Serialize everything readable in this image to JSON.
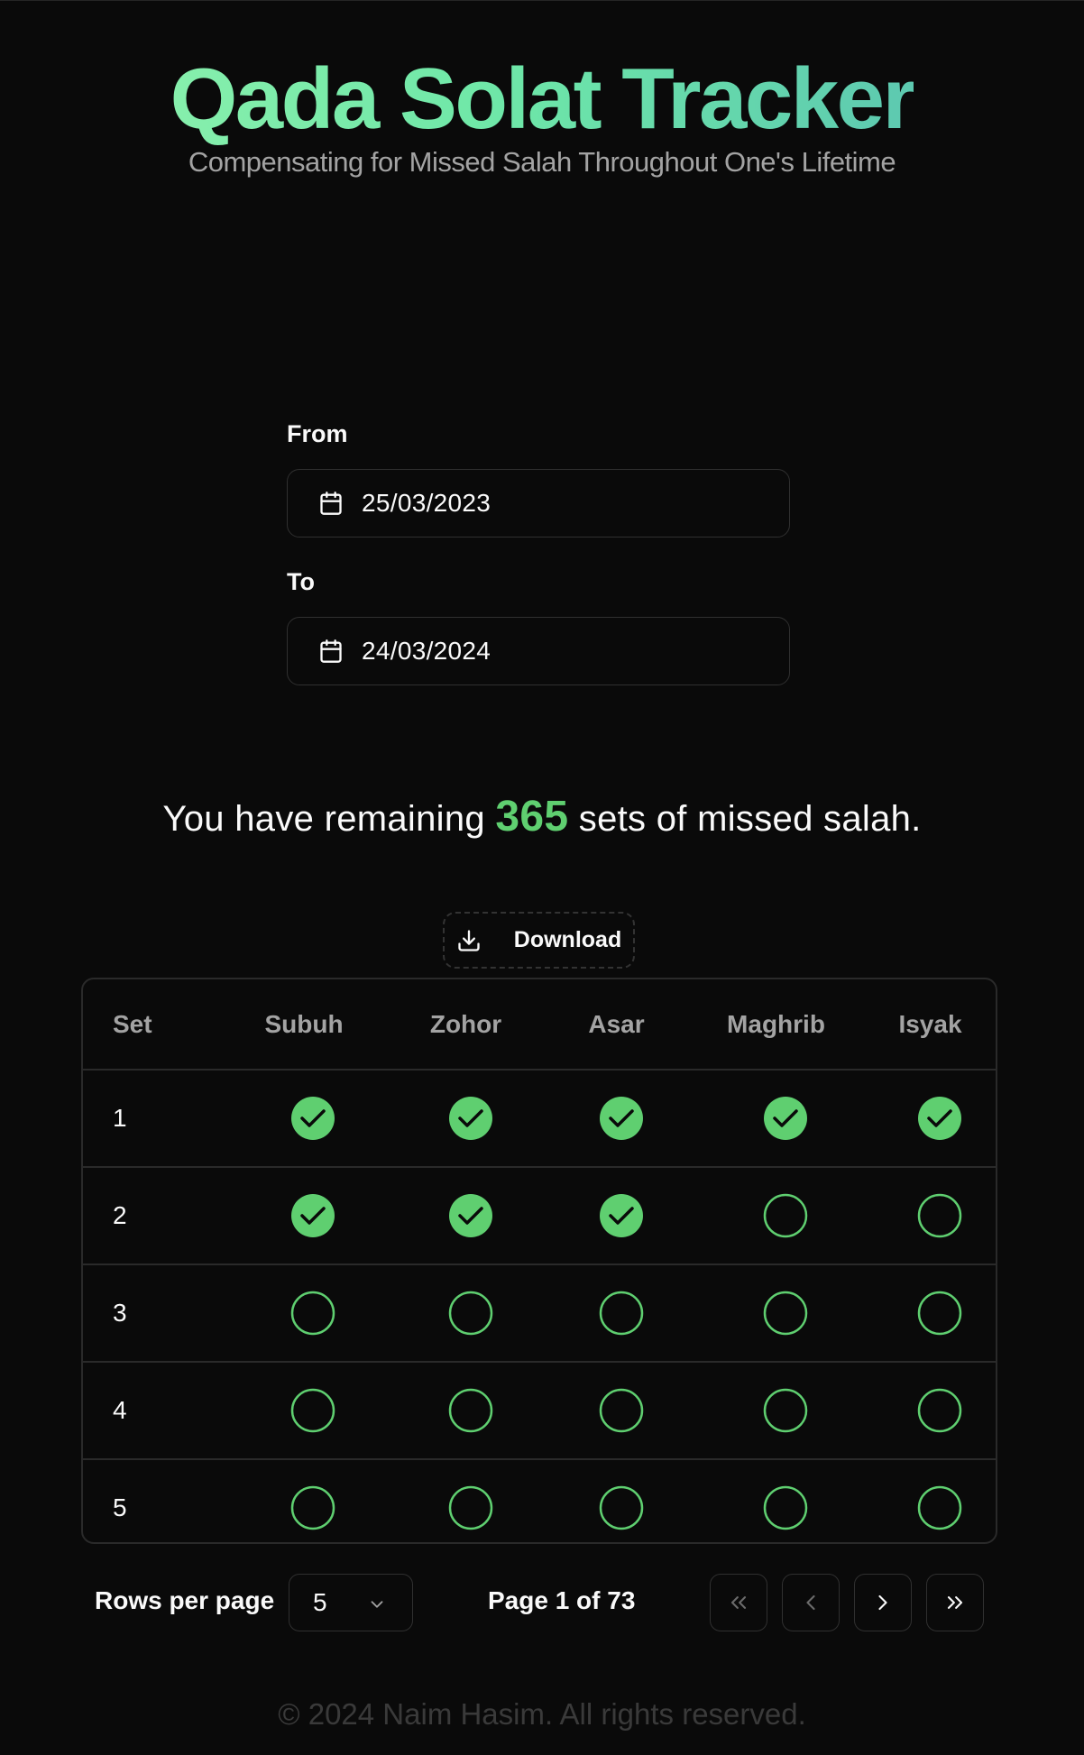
{
  "header": {
    "title": "Qada Solat Tracker",
    "subtitle": "Compensating for Missed Salah Throughout One's Lifetime"
  },
  "form": {
    "from_label": "From",
    "from_value": "25/03/2023",
    "to_label": "To",
    "to_value": "24/03/2024",
    "icon": "calendar-icon"
  },
  "summary": {
    "prefix": "You have remaining",
    "count": "365",
    "suffix": "sets of missed salah."
  },
  "download": {
    "label": "Download",
    "icon": "download-icon"
  },
  "table": {
    "columns": [
      "Set",
      "Subuh",
      "Zohor",
      "Asar",
      "Maghrib",
      "Isyak"
    ],
    "rows": [
      {
        "set": "1",
        "done": [
          true,
          true,
          true,
          true,
          true
        ]
      },
      {
        "set": "2",
        "done": [
          true,
          true,
          true,
          false,
          false
        ]
      },
      {
        "set": "3",
        "done": [
          false,
          false,
          false,
          false,
          false
        ]
      },
      {
        "set": "4",
        "done": [
          false,
          false,
          false,
          false,
          false
        ]
      },
      {
        "set": "5",
        "done": [
          false,
          false,
          false,
          false,
          false
        ]
      }
    ]
  },
  "pagination": {
    "rows_per_page_label": "Rows per page",
    "rows_per_page_value": "5",
    "page_info": "Page 1 of 73"
  },
  "footer": {
    "copyright": "© 2024 Naim Hasim. All rights reserved."
  },
  "colors": {
    "accent": "#5fcf70",
    "background": "#0a0a0a"
  }
}
